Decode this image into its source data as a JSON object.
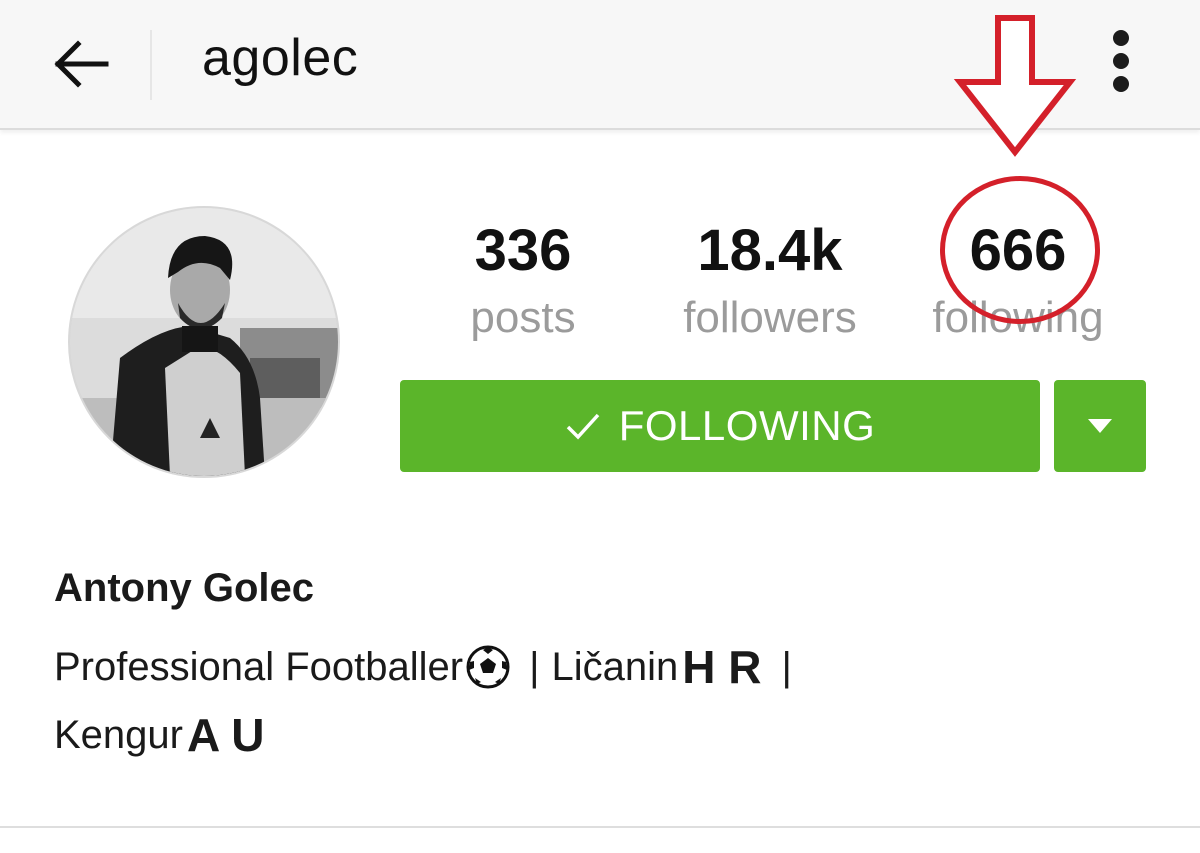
{
  "header": {
    "username": "agolec"
  },
  "profile": {
    "full_name": "Antony Golec",
    "bio": {
      "line1_text": "Professional Footballer",
      "separator": "|",
      "place": "Ličanin",
      "flag1_letters": "H R",
      "line2_text": "Kengur",
      "flag2_letters": "A U"
    }
  },
  "stats": {
    "posts": {
      "value": "336",
      "label": "posts"
    },
    "followers": {
      "value": "18.4k",
      "label": "followers"
    },
    "following": {
      "value": "666",
      "label": "following"
    }
  },
  "actions": {
    "follow_label": "FOLLOWING"
  },
  "colors": {
    "button_green": "#5bb52a",
    "annotation_red": "#d4202a",
    "label_gray": "#9b9b9b"
  },
  "icons": {
    "back": "arrow-left-icon",
    "more": "more-vertical-icon",
    "check": "check-icon",
    "dropdown": "caret-down-icon",
    "ball": "soccer-ball-icon"
  }
}
